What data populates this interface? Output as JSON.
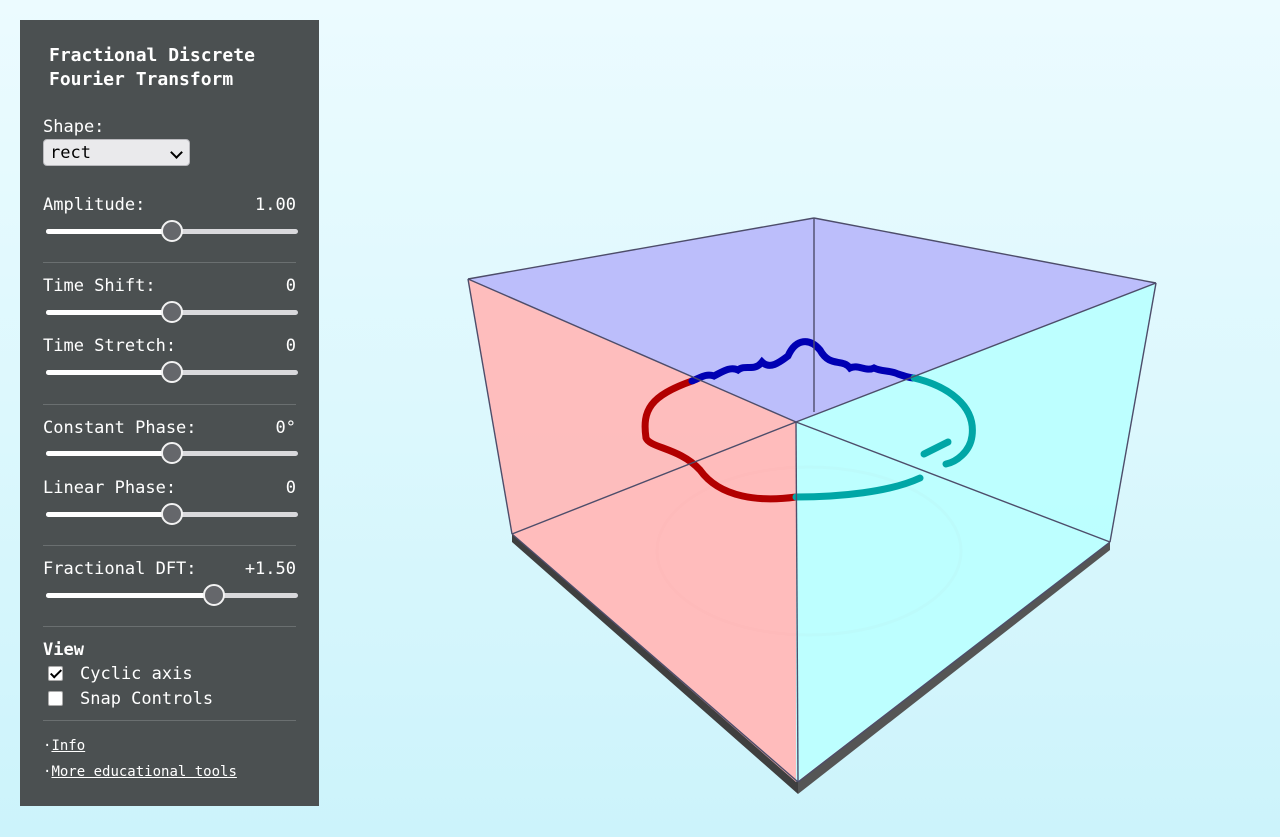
{
  "panel": {
    "title_line1": "Fractional Discrete",
    "title_line2": "Fourier Transform",
    "shape_label": "Shape:",
    "shape_value": "rect",
    "controls": [
      {
        "label": "Amplitude:",
        "value": "1.00",
        "level": 0.5
      },
      {
        "label": "Time Shift:",
        "value": "0",
        "level": 0.5
      },
      {
        "label": "Time Stretch:",
        "value": "0",
        "level": 0.5
      },
      {
        "label": "Constant Phase:",
        "value": "0°",
        "level": 0.5
      },
      {
        "label": "Linear Phase:",
        "value": "0",
        "level": 0.5
      },
      {
        "label": "Fractional DFT:",
        "value": "+1.50",
        "level": 0.667
      }
    ],
    "view_heading": "View",
    "view_options": [
      {
        "label": "Cyclic axis",
        "checked": true
      },
      {
        "label": "Snap Controls",
        "checked": false
      }
    ],
    "links": [
      {
        "bullet": "·",
        "label": "Info"
      },
      {
        "bullet": "·",
        "label": "More educational tools"
      }
    ]
  },
  "scene": {
    "colors": {
      "top_face": "#b9b9fb",
      "left_face": "#ffb9b9",
      "right_face": "#b9ffff",
      "floor_left": "#ffdede",
      "floor_right": "#defffe",
      "curve_red": "#b20000",
      "curve_blue": "#0000b3",
      "curve_teal": "#00a6a6"
    }
  }
}
